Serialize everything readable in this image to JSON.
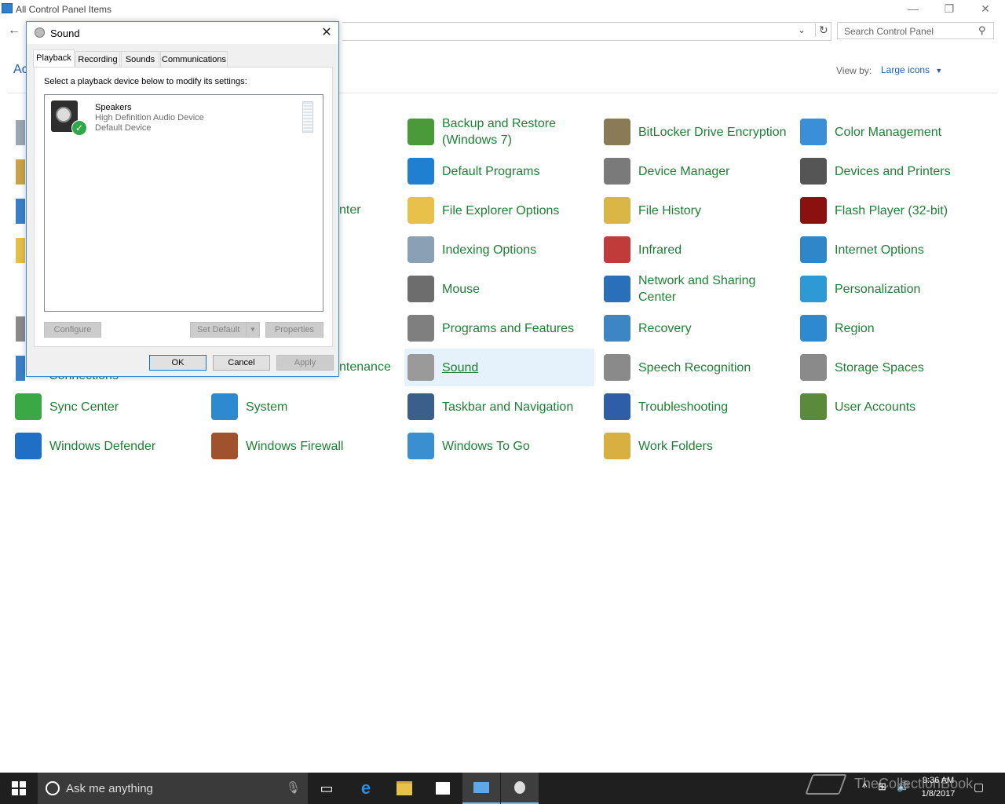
{
  "window": {
    "title": "All Control Panel Items",
    "minimize": "—",
    "restore": "❐",
    "close": "✕"
  },
  "address": {
    "search_placeholder": "Search Control Panel",
    "partial_left": "Ac"
  },
  "view_by": {
    "label": "View by:",
    "value": "Large icons"
  },
  "items": [
    {
      "label": "Backup and Restore\n(Windows 7)",
      "icon": "backup-icon",
      "color": "#4b9a3a"
    },
    {
      "label": "BitLocker Drive Encryption",
      "icon": "bitlocker-icon",
      "color": "#8a7a55"
    },
    {
      "label": "Color Management",
      "icon": "color-management-icon",
      "color": "#3b8ed8"
    },
    {
      "label": "Default Programs",
      "icon": "default-programs-icon",
      "color": "#1f7fd1"
    },
    {
      "label": "Device Manager",
      "icon": "device-manager-icon",
      "color": "#7a7a7a"
    },
    {
      "label": "Devices and Printers",
      "icon": "devices-printers-icon",
      "color": "#555"
    },
    {
      "label": "File Explorer Options",
      "icon": "file-explorer-options-icon",
      "color": "#e8c14a"
    },
    {
      "label": "File History",
      "icon": "file-history-icon",
      "color": "#d9b646"
    },
    {
      "label": "Flash Player (32-bit)",
      "icon": "flash-player-icon",
      "color": "#8b1111"
    },
    {
      "label": "Indexing Options",
      "icon": "indexing-options-icon",
      "color": "#8aa0b5"
    },
    {
      "label": "Infrared",
      "icon": "infrared-icon",
      "color": "#c23b3b"
    },
    {
      "label": "Internet Options",
      "icon": "internet-options-icon",
      "color": "#2f86c9"
    },
    {
      "label": "Mouse",
      "icon": "mouse-icon",
      "color": "#6d6d6d"
    },
    {
      "label": "Network and Sharing\nCenter",
      "icon": "network-sharing-icon",
      "color": "#2a6fba"
    },
    {
      "label": "Personalization",
      "icon": "personalization-icon",
      "color": "#2d9ad6"
    },
    {
      "label": "Programs and Features",
      "icon": "programs-features-icon",
      "color": "#7f7f7f"
    },
    {
      "label": "Recovery",
      "icon": "recovery-icon",
      "color": "#3d86c6"
    },
    {
      "label": "Region",
      "icon": "region-icon",
      "color": "#2d8ad0"
    },
    {
      "label": "Sound",
      "icon": "speaker-icon",
      "color": "#9a9a9a"
    },
    {
      "label": "Speech Recognition",
      "icon": "microphone-icon",
      "color": "#8a8a8a"
    },
    {
      "label": "Storage Spaces",
      "icon": "storage-spaces-icon",
      "color": "#8a8a8a"
    },
    {
      "label": "Taskbar and Navigation",
      "icon": "taskbar-navigation-icon",
      "color": "#3a5f8a"
    },
    {
      "label": "Troubleshooting",
      "icon": "troubleshooting-icon",
      "color": "#2f5ea8"
    },
    {
      "label": "User Accounts",
      "icon": "user-accounts-icon",
      "color": "#5a8a3a"
    },
    {
      "label": "Windows To Go",
      "icon": "windows-to-go-icon",
      "color": "#3a8fd1"
    },
    {
      "label": "Work Folders",
      "icon": "work-folders-icon",
      "color": "#d8b041"
    }
  ],
  "left_items": [
    {
      "label": "Sync Center",
      "icon": "sync-center-icon",
      "color": "#3aa845"
    },
    {
      "label": "System",
      "icon": "system-icon",
      "color": "#2d8ad0"
    },
    {
      "label": "Windows Defender",
      "icon": "windows-defender-icon",
      "color": "#1f6fc6"
    },
    {
      "label": "Windows Firewall",
      "icon": "windows-firewall-icon",
      "color": "#a0522d"
    }
  ],
  "partial_items": {
    "nter": "nter",
    "ntenance": "ntenance",
    "connections": "Connections"
  },
  "dialog": {
    "title": "Sound",
    "tabs": [
      "Playback",
      "Recording",
      "Sounds",
      "Communications"
    ],
    "instruction": "Select a playback device below to modify its settings:",
    "device": {
      "name": "Speakers",
      "description": "High Definition Audio Device",
      "status": "Default Device"
    },
    "buttons": {
      "configure": "Configure",
      "set_default": "Set Default",
      "properties": "Properties",
      "ok": "OK",
      "cancel": "Cancel",
      "apply": "Apply"
    }
  },
  "taskbar": {
    "search_text": "Ask me anything",
    "time": "9:36 AM",
    "date": "1/8/2017",
    "watermark": "TheCollectionBook"
  }
}
